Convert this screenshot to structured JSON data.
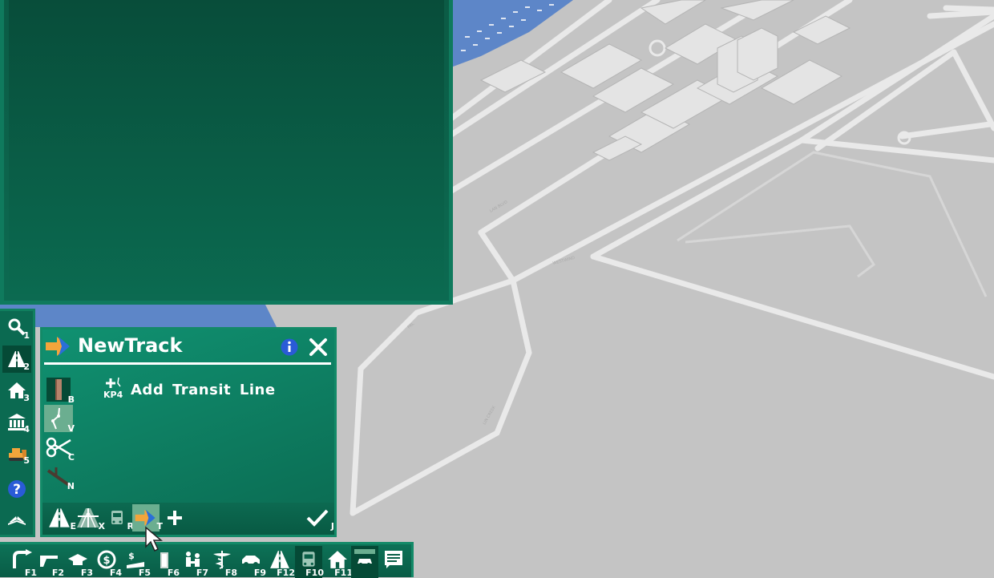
{
  "colors": {
    "panel_green": "#0c6a51",
    "accent_orange": "#f3a53b",
    "water_blue": "#5d86c8",
    "map_gray": "#c4c4c4"
  },
  "sidebar": {
    "items": [
      {
        "icon": "magnifier-icon",
        "key": "1"
      },
      {
        "icon": "road-icon",
        "key": "2",
        "active": true
      },
      {
        "icon": "house-icon",
        "key": "3"
      },
      {
        "icon": "civic-building-icon",
        "key": "4"
      },
      {
        "icon": "bulldozer-icon",
        "key": "5"
      },
      {
        "icon": "help-icon",
        "key": ""
      },
      {
        "icon": "open-book-icon",
        "key": ""
      }
    ]
  },
  "dialog": {
    "title": "NewTrack",
    "add_line": {
      "key": "KP4",
      "label": "Add  Transit  Line"
    },
    "tools": [
      {
        "icon": "track-brush-icon",
        "key": "B"
      },
      {
        "icon": "track-vertex-icon",
        "key": "V",
        "selected": true
      },
      {
        "icon": "scissors-icon",
        "key": "C"
      },
      {
        "icon": "track-network-icon",
        "key": "N"
      }
    ],
    "bottom": [
      {
        "icon": "road-icon",
        "key": "E"
      },
      {
        "icon": "highway-icon",
        "key": "X"
      },
      {
        "icon": "bus-icon",
        "key": "R"
      },
      {
        "icon": "transit-arrow-icon",
        "key": "T",
        "selected": true
      },
      {
        "icon": "plus-icon",
        "key": ""
      },
      {
        "icon": "checkmark-icon",
        "key": "J"
      }
    ]
  },
  "fbar": {
    "items": [
      {
        "icon": "road-build-icon",
        "key": "F1"
      },
      {
        "icon": "gun-icon",
        "key": "F2"
      },
      {
        "icon": "graduation-icon",
        "key": "F3"
      },
      {
        "icon": "money-icon",
        "key": "F4"
      },
      {
        "icon": "budget-icon",
        "key": "F5"
      },
      {
        "icon": "gauge-icon",
        "key": "F6"
      },
      {
        "icon": "population-icon",
        "key": "F7"
      },
      {
        "icon": "health-icon",
        "key": "F8"
      },
      {
        "icon": "car-icon",
        "key": "F9"
      },
      {
        "icon": "road-icon",
        "key": "F12"
      },
      {
        "icon": "bus-icon",
        "key": "F10",
        "active": true
      },
      {
        "icon": "house-icon",
        "key": "F11"
      },
      {
        "icon": "vehicle-icon",
        "key": "",
        "active": true
      },
      {
        "icon": "message-icon",
        "key": ""
      }
    ]
  }
}
